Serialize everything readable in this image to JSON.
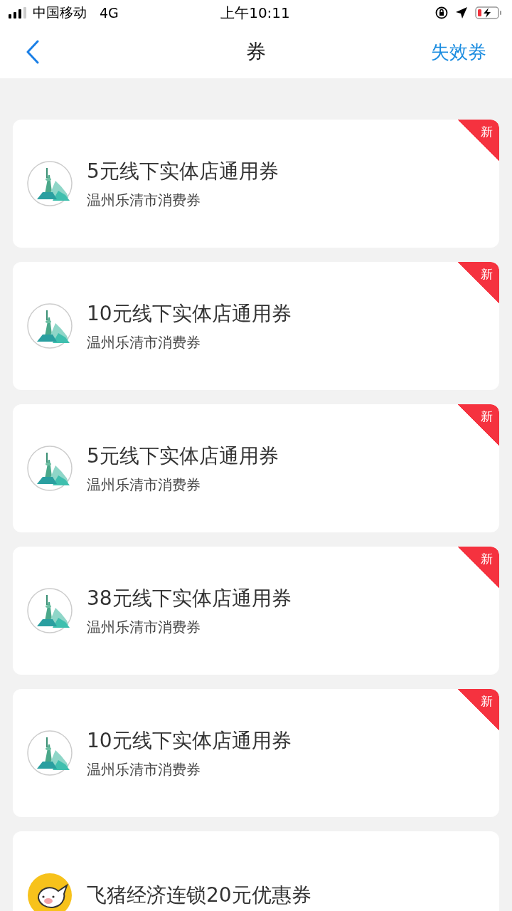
{
  "status_bar": {
    "carrier": "中国移动",
    "network": "4G",
    "time": "上午10:11"
  },
  "nav": {
    "title": "券",
    "action": "失效券"
  },
  "coupons": [
    {
      "kind": "city",
      "title": "5元线下实体店通用券",
      "subtitle": "温州乐清市消费券",
      "is_new": true,
      "badge": "新"
    },
    {
      "kind": "city",
      "title": "10元线下实体店通用券",
      "subtitle": "温州乐清市消费券",
      "is_new": true,
      "badge": "新"
    },
    {
      "kind": "city",
      "title": "5元线下实体店通用券",
      "subtitle": "温州乐清市消费券",
      "is_new": true,
      "badge": "新"
    },
    {
      "kind": "city",
      "title": "38元线下实体店通用券",
      "subtitle": "温州乐清市消费券",
      "is_new": true,
      "badge": "新"
    },
    {
      "kind": "city",
      "title": "10元线下实体店通用券",
      "subtitle": "温州乐清市消费券",
      "is_new": true,
      "badge": "新"
    },
    {
      "kind": "pig",
      "title": "飞猪经济连锁20元优惠券",
      "is_new": false
    }
  ]
}
